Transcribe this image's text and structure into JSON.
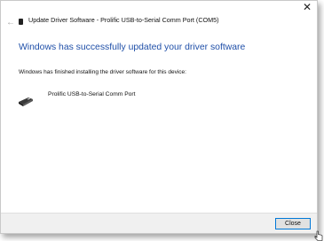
{
  "window": {
    "title": "Update Driver Software - Prolific USB-to-Serial Comm Port (COM5)",
    "close_glyph": "✕"
  },
  "nav": {
    "back_glyph": "←"
  },
  "content": {
    "heading": "Windows has successfully updated your driver software",
    "info": "Windows has finished installing the driver software for this device:",
    "device_name": "Prolific USB-to-Serial Comm Port"
  },
  "footer": {
    "close_label": "Close"
  },
  "colors": {
    "heading": "#1f4fa8",
    "focus_border": "#0078d7",
    "footer_bg": "#f0f0f0"
  }
}
